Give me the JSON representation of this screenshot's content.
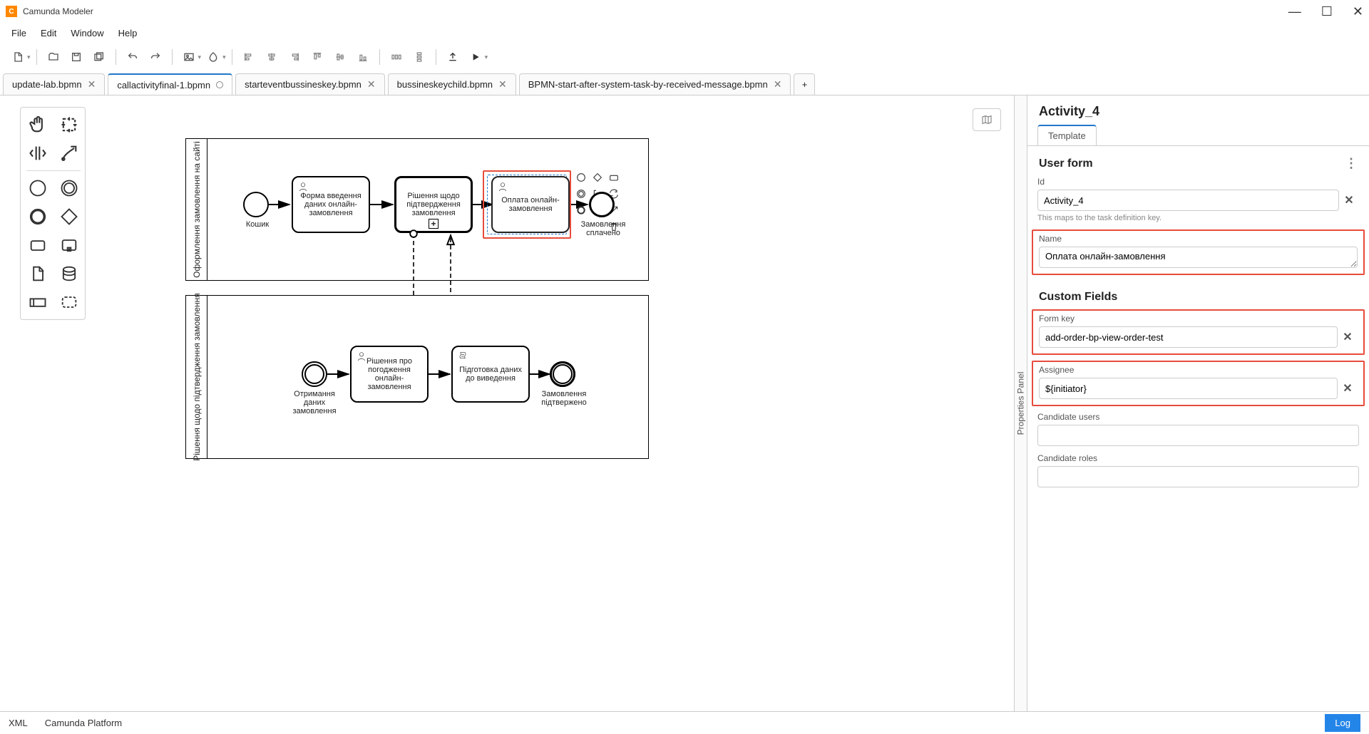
{
  "app": {
    "title": "Camunda Modeler"
  },
  "menubar": [
    "File",
    "Edit",
    "Window",
    "Help"
  ],
  "tabs": [
    {
      "label": "update-lab.bpmn",
      "active": false
    },
    {
      "label": "callactivityfinal-1.bpmn",
      "active": true,
      "dirty": true
    },
    {
      "label": "starteventbussineskey.bpmn",
      "active": false
    },
    {
      "label": "bussineskeychild.bpmn",
      "active": false
    },
    {
      "label": "BPMN-start-after-system-task-by-received-message.bpmn",
      "active": false
    }
  ],
  "pools": {
    "p1": {
      "title": "Оформлення замовлення на сайті"
    },
    "p2": {
      "title": "Рішення щодо підтвердження замовлення"
    }
  },
  "nodes": {
    "p1_start": "Кошик",
    "p1_task1": "Форма введення даних онлайн-замовлення",
    "p1_task2": "Рішення щодо підтвердження замовлення",
    "p1_task3": "Оплата онлайн-замовлення",
    "p1_end": "Замовлення сплачено",
    "p2_start": "Отримання даних замовлення",
    "p2_task1": "Рішення про погодження онлайн-замовлення",
    "p2_task2": "Підготовка даних до виведення",
    "p2_end": "Замовлення підтвержено"
  },
  "properties": {
    "header": "Activity_4",
    "tab": "Template",
    "section_userform": "User form",
    "id_label": "Id",
    "id_value": "Activity_4",
    "id_help": "This maps to the task definition key.",
    "name_label": "Name",
    "name_value": "Оплата онлайн-замовлення",
    "section_custom": "Custom Fields",
    "formkey_label": "Form key",
    "formkey_value": "add-order-bp-view-order-test",
    "assignee_label": "Assignee",
    "assignee_value": "${initiator}",
    "cand_users_label": "Candidate users",
    "cand_users_value": "",
    "cand_roles_label": "Candidate roles",
    "cand_roles_value": ""
  },
  "props_handle": "Properties Panel",
  "status": {
    "left1": "XML",
    "left2": "Camunda Platform",
    "right": "Log"
  }
}
